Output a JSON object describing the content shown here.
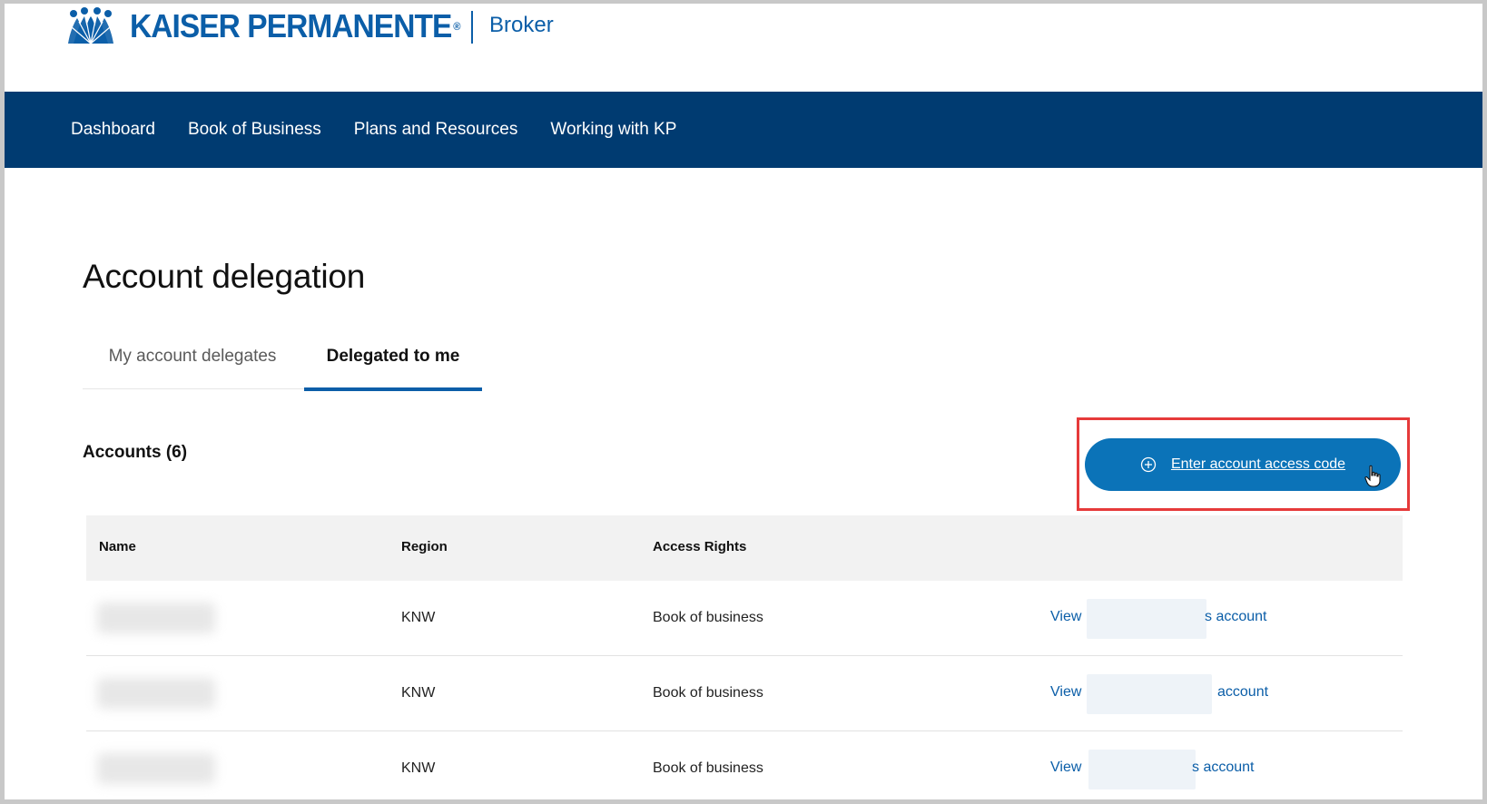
{
  "header": {
    "logo_text": "KAISER PERMANENTE",
    "logo_reg": "®",
    "portal_name": "Broker"
  },
  "nav": {
    "items": [
      "Dashboard",
      "Book of Business",
      "Plans and Resources",
      "Working with KP"
    ]
  },
  "main": {
    "title": "Account delegation",
    "tabs": [
      {
        "label": "My account delegates",
        "active": false
      },
      {
        "label": "Delegated to me",
        "active": true
      }
    ],
    "accounts_label": "Accounts (6)",
    "cta_label": "Enter account access code",
    "table": {
      "headers": [
        "Name",
        "Region",
        "Access Rights"
      ],
      "rows": [
        {
          "region": "KNW",
          "access": "Book of business",
          "view": "View",
          "account_suffix": "s account"
        },
        {
          "region": "KNW",
          "access": "Book of business",
          "view": "View",
          "account_suffix": "account"
        },
        {
          "region": "KNW",
          "access": "Book of business",
          "view": "View",
          "account_suffix": "s account"
        }
      ]
    }
  },
  "colors": {
    "brand_blue": "#0b5ea8",
    "nav_bg": "#003b71",
    "cta_bg": "#0b73b8",
    "highlight": "#e63a3a"
  },
  "icons": [
    "kp-logo-icon",
    "plus-circle-icon",
    "hand-pointer-icon"
  ]
}
